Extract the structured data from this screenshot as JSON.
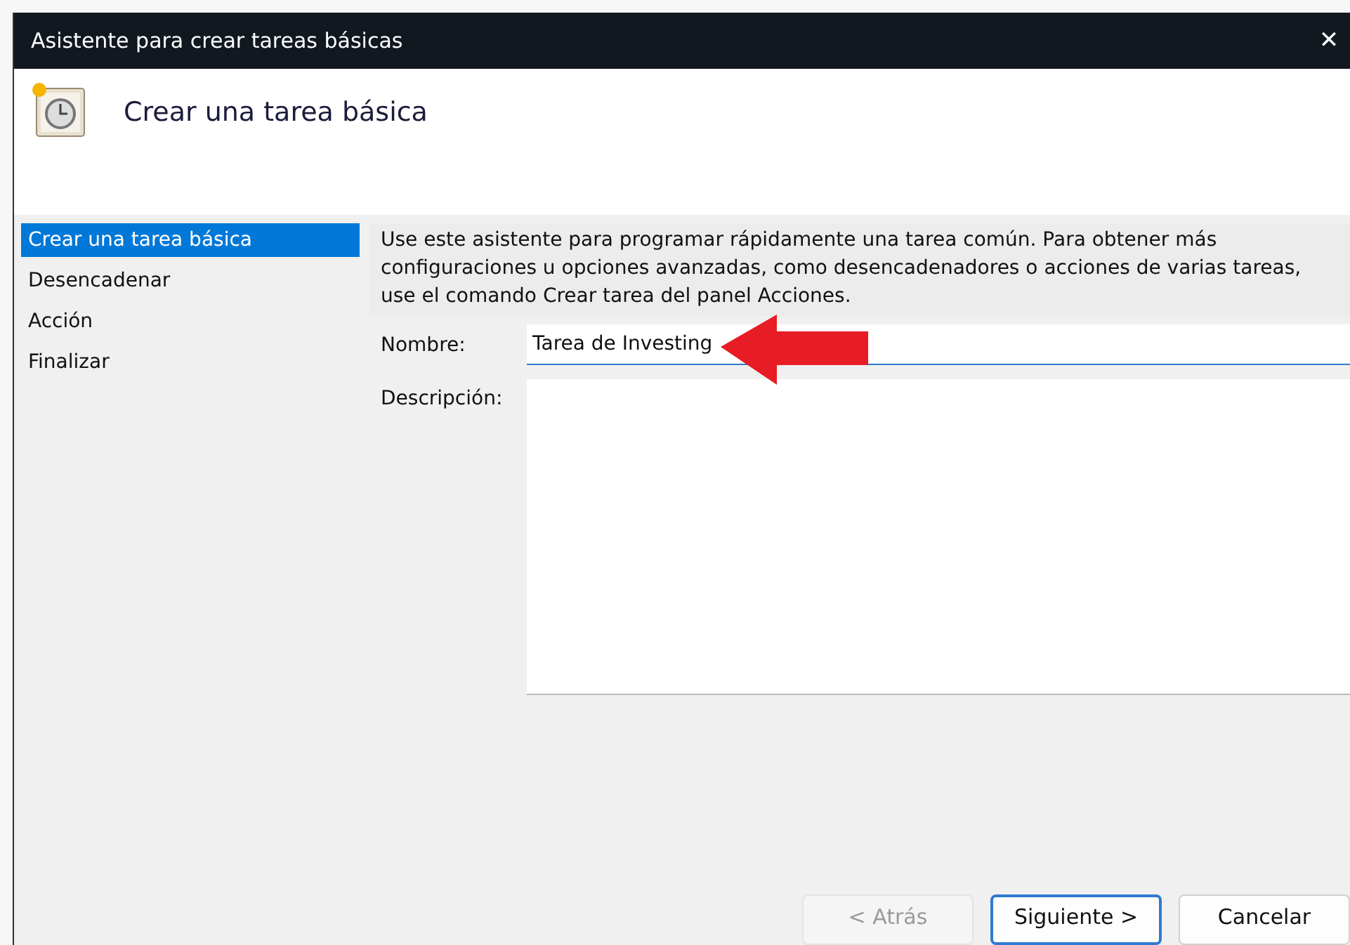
{
  "window": {
    "title": "Asistente para crear tareas básicas",
    "close": "✕"
  },
  "header": {
    "title": "Crear una tarea básica"
  },
  "steps": [
    {
      "label": "Crear una tarea básica",
      "selected": true
    },
    {
      "label": "Desencadenar",
      "selected": false
    },
    {
      "label": "Acción",
      "selected": false
    },
    {
      "label": "Finalizar",
      "selected": false
    }
  ],
  "intro": "Use este asistente para programar rápidamente una tarea común. Para obtener más configuraciones u opciones avanzadas, como desencadenadores o acciones de varias tareas, use el comando Crear tarea del panel Acciones.",
  "name_field": {
    "label": "Nombre:",
    "value": "Tarea de Investing"
  },
  "description_field": {
    "label": "Descripción:"
  },
  "buttons": [
    {
      "label": "< Atrás",
      "disabled": true,
      "focused": false
    },
    {
      "label": "Siguiente >",
      "disabled": false,
      "focused": true
    },
    {
      "label": "Cancelar",
      "disabled": false,
      "focused": false
    }
  ]
}
